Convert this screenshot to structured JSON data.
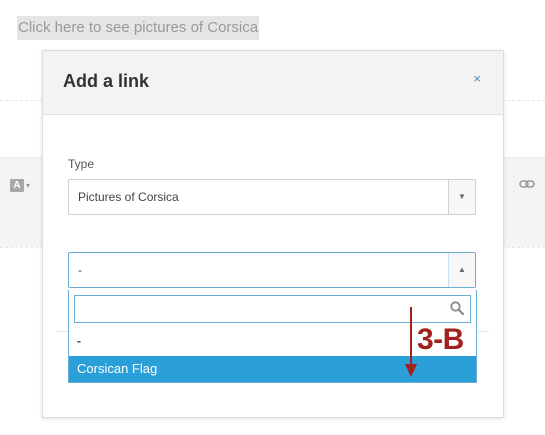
{
  "background": {
    "link_text": "Click here to see pictures of Corsica",
    "text_style_icon": "A"
  },
  "modal": {
    "title": "Add a link",
    "close_label": "×",
    "type_label": "Type",
    "type_value": "Pictures of Corsica",
    "item_value": "-",
    "search": {
      "value": "",
      "placeholder": ""
    },
    "options": [
      "-",
      "Corsican Flag"
    ],
    "selected_option": "Corsican Flag"
  },
  "annotation": {
    "label": "3-B",
    "color": "#a3211c"
  },
  "colors": {
    "highlight": "#2a9fd8",
    "focus_border": "#6aaed6",
    "link": "#4a90c8",
    "danger": "#d9534f",
    "success": "#5cb85c"
  },
  "icons": [
    "text-style-icon",
    "link-chain-icon",
    "close-icon",
    "caret-down-icon",
    "caret-up-icon",
    "search-icon"
  ]
}
